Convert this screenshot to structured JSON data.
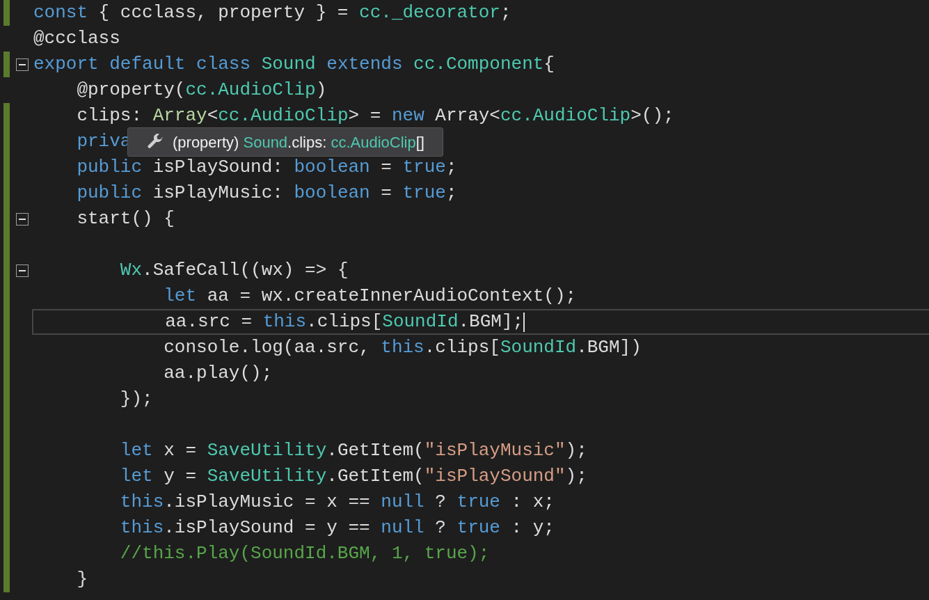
{
  "editor": {
    "lines": [
      {
        "changed": true,
        "fold": false,
        "current": false,
        "tokens": [
          {
            "kind": "keyword",
            "text": "const"
          },
          {
            "kind": "plain",
            "text": " { ccclass, property } = "
          },
          {
            "kind": "type",
            "text": "cc._decorator"
          },
          {
            "kind": "plain",
            "text": ";"
          }
        ]
      },
      {
        "changed": false,
        "fold": false,
        "current": false,
        "tokens": [
          {
            "kind": "plain",
            "text": "@ccclass"
          }
        ]
      },
      {
        "changed": true,
        "fold": true,
        "current": false,
        "tokens": [
          {
            "kind": "keyword",
            "text": "export default class "
          },
          {
            "kind": "type",
            "text": "Sound"
          },
          {
            "kind": "keyword",
            "text": " extends "
          },
          {
            "kind": "type",
            "text": "cc.Component"
          },
          {
            "kind": "plain",
            "text": "{"
          }
        ]
      },
      {
        "changed": false,
        "fold": false,
        "current": false,
        "tokens": [
          {
            "kind": "plain",
            "text": "    @property("
          },
          {
            "kind": "type",
            "text": "cc.AudioClip"
          },
          {
            "kind": "plain",
            "text": ")"
          }
        ]
      },
      {
        "changed": true,
        "fold": false,
        "current": false,
        "tokens": [
          {
            "kind": "plain",
            "text": "    clips: "
          },
          {
            "kind": "interface",
            "text": "Array"
          },
          {
            "kind": "plain",
            "text": "<"
          },
          {
            "kind": "type",
            "text": "cc.AudioClip"
          },
          {
            "kind": "plain",
            "text": "> = "
          },
          {
            "kind": "keyword",
            "text": "new"
          },
          {
            "kind": "plain",
            "text": " Array<"
          },
          {
            "kind": "type",
            "text": "cc.AudioClip"
          },
          {
            "kind": "plain",
            "text": ">();"
          }
        ]
      },
      {
        "changed": true,
        "fold": false,
        "current": false,
        "tokens": [
          {
            "kind": "keyword",
            "text": "    priva"
          }
        ],
        "tooltip": {
          "tokens": [
            {
              "kind": "plain",
              "text": "(property) "
            },
            {
              "kind": "type",
              "text": "Sound"
            },
            {
              "kind": "plain",
              "text": ".clips: "
            },
            {
              "kind": "type",
              "text": "cc.AudioClip"
            },
            {
              "kind": "plain",
              "text": "[]"
            }
          ]
        }
      },
      {
        "changed": true,
        "fold": false,
        "current": false,
        "tokens": [
          {
            "kind": "keyword",
            "text": "    public"
          },
          {
            "kind": "plain",
            "text": " isPlaySound: "
          },
          {
            "kind": "keyword",
            "text": "boolean"
          },
          {
            "kind": "plain",
            "text": " = "
          },
          {
            "kind": "keyword",
            "text": "true"
          },
          {
            "kind": "plain",
            "text": ";"
          }
        ]
      },
      {
        "changed": true,
        "fold": false,
        "current": false,
        "tokens": [
          {
            "kind": "keyword",
            "text": "    public"
          },
          {
            "kind": "plain",
            "text": " isPlayMusic: "
          },
          {
            "kind": "keyword",
            "text": "boolean"
          },
          {
            "kind": "plain",
            "text": " = "
          },
          {
            "kind": "keyword",
            "text": "true"
          },
          {
            "kind": "plain",
            "text": ";"
          }
        ]
      },
      {
        "changed": true,
        "fold": true,
        "current": false,
        "tokens": [
          {
            "kind": "plain",
            "text": "    start() {"
          }
        ]
      },
      {
        "changed": true,
        "fold": false,
        "current": false
      },
      {
        "changed": true,
        "fold": true,
        "current": false,
        "tokens": [
          {
            "kind": "type",
            "text": "        Wx"
          },
          {
            "kind": "plain",
            "text": ".SafeCall((wx) => {"
          }
        ]
      },
      {
        "changed": true,
        "fold": false,
        "current": false,
        "tokens": [
          {
            "kind": "keyword",
            "text": "            let"
          },
          {
            "kind": "plain",
            "text": " aa = wx.createInnerAudioContext();"
          }
        ]
      },
      {
        "changed": true,
        "fold": false,
        "current": true,
        "tokens": [
          {
            "kind": "plain",
            "text": "            aa.src = "
          },
          {
            "kind": "keyword",
            "text": "this"
          },
          {
            "kind": "plain",
            "text": ".clips["
          },
          {
            "kind": "type",
            "text": "SoundId"
          },
          {
            "kind": "plain",
            "text": ".BGM];"
          }
        ]
      },
      {
        "changed": true,
        "fold": false,
        "current": false,
        "tokens": [
          {
            "kind": "plain",
            "text": "            console.log(aa.src, "
          },
          {
            "kind": "keyword",
            "text": "this"
          },
          {
            "kind": "plain",
            "text": ".clips["
          },
          {
            "kind": "type",
            "text": "SoundId"
          },
          {
            "kind": "plain",
            "text": ".BGM])"
          }
        ]
      },
      {
        "changed": true,
        "fold": false,
        "current": false,
        "tokens": [
          {
            "kind": "plain",
            "text": "            aa.play();"
          }
        ]
      },
      {
        "changed": true,
        "fold": false,
        "current": false,
        "tokens": [
          {
            "kind": "plain",
            "text": "        });"
          }
        ]
      },
      {
        "changed": true,
        "fold": false,
        "current": false
      },
      {
        "changed": true,
        "fold": false,
        "current": false,
        "tokens": [
          {
            "kind": "keyword",
            "text": "        let"
          },
          {
            "kind": "plain",
            "text": " x = "
          },
          {
            "kind": "type",
            "text": "SaveUtility"
          },
          {
            "kind": "plain",
            "text": ".GetItem("
          },
          {
            "kind": "string",
            "text": "\"isPlayMusic\""
          },
          {
            "kind": "plain",
            "text": ");"
          }
        ]
      },
      {
        "changed": true,
        "fold": false,
        "current": false,
        "tokens": [
          {
            "kind": "keyword",
            "text": "        let"
          },
          {
            "kind": "plain",
            "text": " y = "
          },
          {
            "kind": "type",
            "text": "SaveUtility"
          },
          {
            "kind": "plain",
            "text": ".GetItem("
          },
          {
            "kind": "string",
            "text": "\"isPlaySound\""
          },
          {
            "kind": "plain",
            "text": ");"
          }
        ]
      },
      {
        "changed": true,
        "fold": false,
        "current": false,
        "tokens": [
          {
            "kind": "keyword",
            "text": "        this"
          },
          {
            "kind": "plain",
            "text": ".isPlayMusic = x == "
          },
          {
            "kind": "keyword",
            "text": "null"
          },
          {
            "kind": "plain",
            "text": " ? "
          },
          {
            "kind": "keyword",
            "text": "true"
          },
          {
            "kind": "plain",
            "text": " : x;"
          }
        ]
      },
      {
        "changed": true,
        "fold": false,
        "current": false,
        "tokens": [
          {
            "kind": "keyword",
            "text": "        this"
          },
          {
            "kind": "plain",
            "text": ".isPlaySound = y == "
          },
          {
            "kind": "keyword",
            "text": "null"
          },
          {
            "kind": "plain",
            "text": " ? "
          },
          {
            "kind": "keyword",
            "text": "true"
          },
          {
            "kind": "plain",
            "text": " : y;"
          }
        ]
      },
      {
        "changed": true,
        "fold": false,
        "current": false,
        "tokens": [
          {
            "kind": "comment",
            "text": "        //this.Play(SoundId.BGM, 1, true);"
          }
        ]
      },
      {
        "changed": true,
        "fold": false,
        "current": false,
        "tokens": [
          {
            "kind": "plain",
            "text": "    }"
          }
        ]
      }
    ]
  }
}
